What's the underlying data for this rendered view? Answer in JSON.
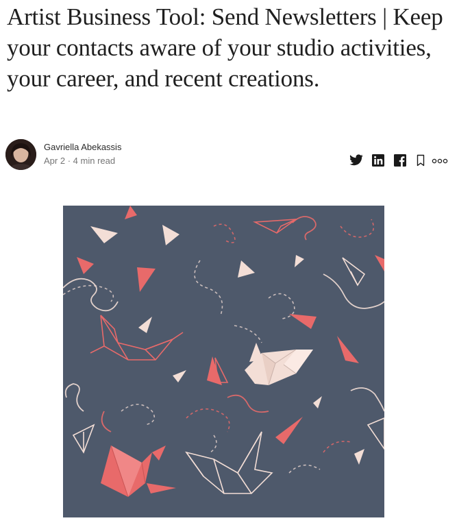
{
  "article": {
    "title": "Artist Business Tool: Send Newsletters | Keep your contacts aware of your studio activities, your career, and recent creations.",
    "author": "Gavriella Abekassis",
    "date": "Apr 2",
    "separator": "·",
    "read_time": "4 min read"
  },
  "actions": [
    {
      "icon": "twitter-icon"
    },
    {
      "icon": "linkedin-icon"
    },
    {
      "icon": "facebook-icon"
    },
    {
      "icon": "bookmark-icon"
    },
    {
      "icon": "more-icon"
    }
  ],
  "hero_image": {
    "description_icons": [
      "paper-crane",
      "paper-plane",
      "confetti-triangle",
      "dashed-flight-path"
    ]
  },
  "colors": {
    "title": "#1f1f1f",
    "meta": "#757575",
    "icon": "#1a1a1a",
    "hero_background": "#4e596b",
    "hero_coral": "#e86a6a",
    "hero_cream": "#f3ded6"
  }
}
